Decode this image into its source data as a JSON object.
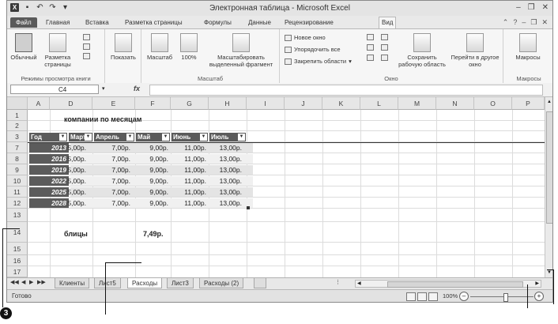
{
  "window": {
    "title": "Электронная таблица - Microsoft Excel",
    "qat": [
      "excel-logo-icon",
      "save-icon",
      "undo-icon",
      "redo-icon"
    ],
    "controls": [
      "minimize-icon",
      "restore-icon",
      "close-icon"
    ]
  },
  "tabs": [
    {
      "label": "Файл"
    },
    {
      "label": "Главная"
    },
    {
      "label": "Вставка"
    },
    {
      "label": "Разметка страницы"
    },
    {
      "label": "Формулы"
    },
    {
      "label": "Данные"
    },
    {
      "label": "Рецензирование"
    },
    {
      "label": "Вид"
    }
  ],
  "ribbon": {
    "groups": [
      {
        "label": "Режимы просмотра книги",
        "buttons": [
          "Обычный",
          "Разметка страницы"
        ]
      },
      {
        "label": "",
        "buttons": [
          "Показать"
        ]
      },
      {
        "label": "Масштаб",
        "buttons": [
          "Масштаб",
          "100%",
          "Масштабировать выделенный фрагмент"
        ]
      },
      {
        "label": "Окно",
        "items": [
          "Новое окно",
          "Упорядочить все",
          "Закрепить области"
        ],
        "buttons": [
          "Сохранить рабочую область",
          "Перейти в другое окно"
        ]
      },
      {
        "label": "Макросы",
        "buttons": [
          "Макросы"
        ]
      }
    ]
  },
  "formula_bar": {
    "name_box": "C4",
    "fx": "fx",
    "value": ""
  },
  "columns": [
    "A",
    "D",
    "E",
    "F",
    "G",
    "H",
    "I",
    "J",
    "K",
    "L",
    "M",
    "N",
    "O",
    "P"
  ],
  "rows": [
    "1",
    "2",
    "3",
    "7",
    "8",
    "9",
    "10",
    "11",
    "12",
    "13",
    "14",
    "15",
    "16",
    "17"
  ],
  "sheet": {
    "title_text": "компании по месяцам",
    "header": [
      "Год",
      "Март",
      "Апрель",
      "Май",
      "Июнь",
      "Июль"
    ],
    "data": [
      {
        "year": "2013",
        "vals": [
          "5,00р.",
          "7,00р.",
          "9,00р.",
          "11,00р.",
          "13,00р."
        ]
      },
      {
        "year": "2016",
        "vals": [
          "5,00р.",
          "7,00р.",
          "9,00р.",
          "11,00р.",
          "13,00р."
        ]
      },
      {
        "year": "2019",
        "vals": [
          "5,00р.",
          "7,00р.",
          "9,00р.",
          "11,00р.",
          "13,00р."
        ]
      },
      {
        "year": "2022",
        "vals": [
          "5,00р.",
          "7,00р.",
          "9,00р.",
          "11,00р.",
          "13,00р."
        ]
      },
      {
        "year": "2025",
        "vals": [
          "5,00р.",
          "7,00р.",
          "9,00р.",
          "11,00р.",
          "13,00р."
        ]
      },
      {
        "year": "2028",
        "vals": [
          "5,00р.",
          "7,00р.",
          "9,00р.",
          "11,00р.",
          "13,00р."
        ]
      }
    ],
    "summary_label": "блицы",
    "summary_value": "7,49р."
  },
  "sheet_tabs": [
    {
      "label": "Клиенты"
    },
    {
      "label": "Лист5"
    },
    {
      "label": "Расходы",
      "active": true
    },
    {
      "label": "Лист3"
    },
    {
      "label": "Расходы (2)"
    }
  ],
  "status": {
    "text": "Готово",
    "zoom": "100%"
  },
  "callout_marker": "3",
  "colors": {
    "header_fill": "#5b5b5b",
    "band_fill": "#e4e4e4"
  }
}
